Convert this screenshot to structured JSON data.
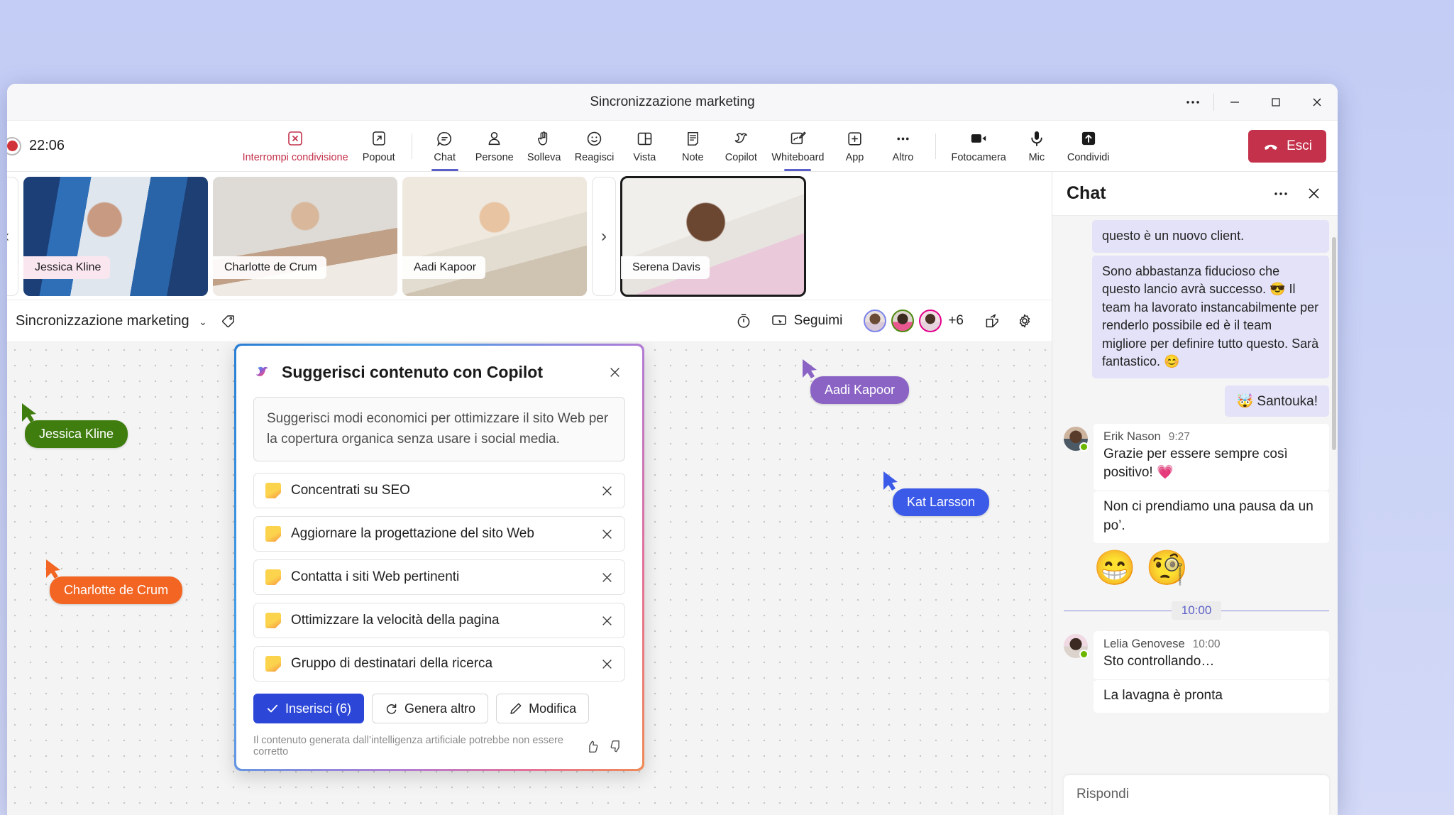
{
  "window": {
    "title": "Sincronizzazione marketing",
    "controls": {
      "more": "…",
      "minimize": "—",
      "maximize": "☐",
      "close": "✕"
    }
  },
  "meeting_toolbar": {
    "recording_time": "22:06",
    "items": [
      {
        "label": "Interrompi condivisione",
        "icon": "stop-sharing-icon",
        "danger": true,
        "active": false
      },
      {
        "label": "Popout",
        "icon": "popout-icon",
        "danger": false,
        "active": false
      },
      {
        "label": "Chat",
        "icon": "chat-icon",
        "danger": false,
        "active": true
      },
      {
        "label": "Persone",
        "icon": "people-icon",
        "danger": false,
        "active": false
      },
      {
        "label": "Solleva",
        "icon": "raise-hand-icon",
        "danger": false,
        "active": false
      },
      {
        "label": "Reagisci",
        "icon": "react-icon",
        "danger": false,
        "active": false
      },
      {
        "label": "Vista",
        "icon": "view-icon",
        "danger": false,
        "active": false
      },
      {
        "label": "Note",
        "icon": "notes-icon",
        "danger": false,
        "active": false
      },
      {
        "label": "Copilot",
        "icon": "copilot-icon",
        "danger": false,
        "active": false
      },
      {
        "label": "Whiteboard",
        "icon": "whiteboard-icon",
        "danger": false,
        "active": true
      },
      {
        "label": "App",
        "icon": "apps-icon",
        "danger": false,
        "active": false
      },
      {
        "label": "Altro",
        "icon": "more-icon",
        "danger": false,
        "active": false
      },
      {
        "label": "Fotocamera",
        "icon": "camera-icon",
        "danger": false,
        "active": false
      },
      {
        "label": "Mic",
        "icon": "microphone-icon",
        "danger": false,
        "active": false
      },
      {
        "label": "Condividi",
        "icon": "share-screen-icon",
        "danger": false,
        "active": false
      }
    ],
    "leave_label": "Esci",
    "leave_color": "#c4314b"
  },
  "filmstrip": {
    "prev_label": "‹",
    "next_label": "›",
    "tiles": [
      {
        "name": "Jessica Kline",
        "chip_style": "pink",
        "spotlight": false
      },
      {
        "name": "Charlotte de Crum",
        "chip_style": "white",
        "spotlight": false
      },
      {
        "name": "Aadi Kapoor",
        "chip_style": "white",
        "spotlight": false
      },
      {
        "name": "Serena Davis",
        "chip_style": "white",
        "spotlight": true
      }
    ]
  },
  "whiteboard_header": {
    "title": "Sincronizzazione marketing",
    "chevron": "⌄",
    "tag_icon": "tag-icon",
    "timer_icon": "timer-icon",
    "follow_label": "Seguimi",
    "follow_icon": "follow-me-icon",
    "avatar_overflow": "+6",
    "share_icon": "share-icon",
    "settings_icon": "gear-icon"
  },
  "whiteboard": {
    "cursors": [
      {
        "name": "Jessica Kline",
        "color": "#3f7d0e"
      },
      {
        "name": "Charlotte de Crum",
        "color": "#f26522"
      },
      {
        "name": "Aadi Kapoor",
        "color": "#8a63c4"
      },
      {
        "name": "Kat Larsson",
        "color": "#3b5ae8"
      }
    ]
  },
  "copilot_card": {
    "icon": "copilot-icon",
    "title": "Suggerisci contenuto con Copilot",
    "close_label": "✕",
    "prompt": "Suggerisci modi economici per ottimizzare il sito Web per la copertura organica senza usare i social media.",
    "suggestions": [
      "Concentrati su SEO",
      "Aggiornare la progettazione del sito Web",
      "Contatta i siti Web pertinenti",
      "Ottimizzare la velocità della pagina",
      "Gruppo di destinatari della ricerca"
    ],
    "remove_label": "✕",
    "actions": {
      "insert": "Inserisci (6)",
      "regenerate": "Genera altro",
      "edit": "Modifica"
    },
    "disclaimer": "Il contenuto generata dall’intelligenza artificiale potrebbe non essere corretto",
    "thumbs_up_icon": "thumbs-up-icon",
    "thumbs_down_icon": "thumbs-down-icon",
    "accent_primary": "#2c47d8"
  },
  "chat_panel": {
    "title": "Chat",
    "more_label": "…",
    "close_label": "✕",
    "messages": [
      {
        "kind": "out",
        "text": "questo è un nuovo client."
      },
      {
        "kind": "out",
        "text": "Sono abbastanza fiducioso che questo lancio avrà successo. 😎 Il team ha lavorato instancabilmente per renderlo possibile ed è il team migliore per definire tutto questo. Sarà fantastico. 😊"
      },
      {
        "kind": "out_short",
        "text": "🤯 Santouka!"
      },
      {
        "kind": "in",
        "sender": "Erik Nason",
        "time": "9:27",
        "text": "Grazie per essere sempre così positivo! 💗"
      },
      {
        "kind": "in_cont",
        "text": "Non ci prendiamo una pausa da un po’."
      },
      {
        "kind": "reactions",
        "emojis": [
          "😁",
          "🧐"
        ]
      },
      {
        "kind": "divider",
        "label": "10:00"
      },
      {
        "kind": "in",
        "sender": "Lelia Genovese",
        "time": "10:00",
        "text": "Sto controllando…"
      },
      {
        "kind": "in_cont",
        "text": "La lavagna è pronta"
      }
    ],
    "compose_placeholder": "Rispondi"
  }
}
